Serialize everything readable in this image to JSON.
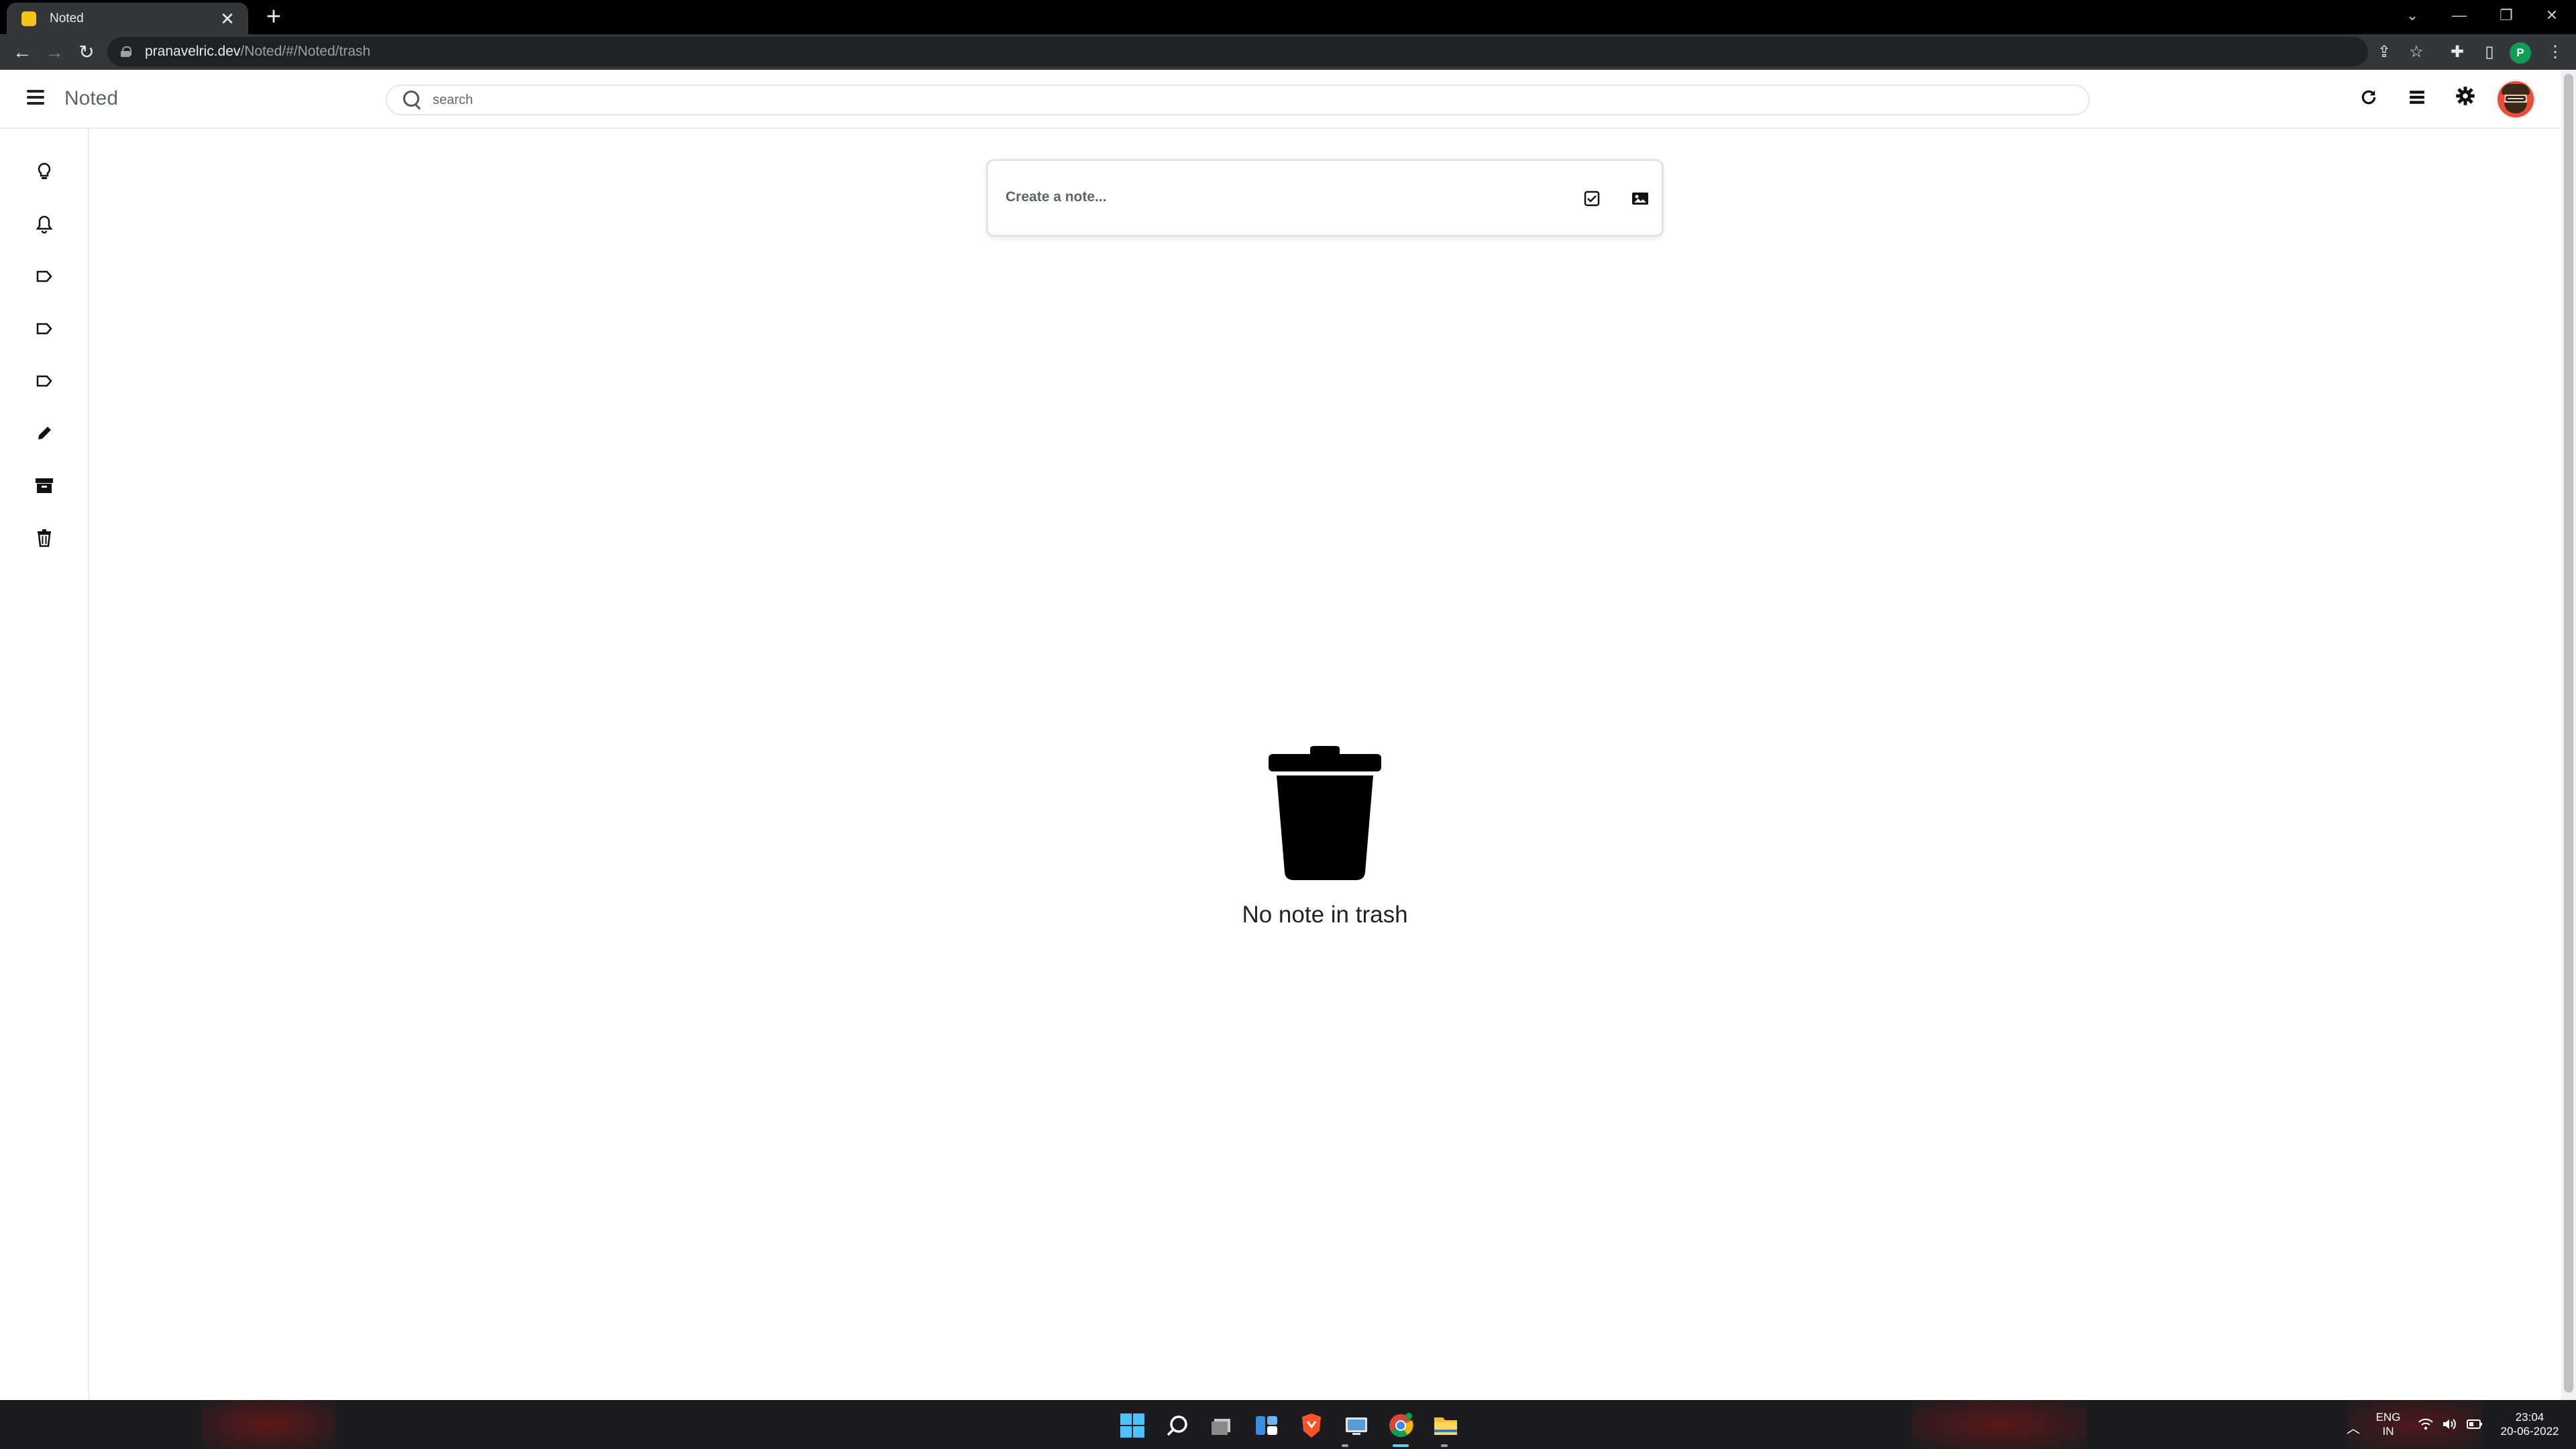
{
  "browser": {
    "tab_title": "Noted",
    "tab_close": "✕",
    "new_tab": "+",
    "url_host": "pranavelric.dev",
    "url_path": "/Noted/#/Noted/trash",
    "profile_initial": "P"
  },
  "app": {
    "title": "Noted",
    "search_placeholder": "search"
  },
  "note_input": {
    "placeholder": "Create a note..."
  },
  "empty_state": {
    "message": "No note in trash",
    "icon": "trash-icon"
  },
  "sidebar": {
    "items": [
      {
        "icon": "lightbulb-icon"
      },
      {
        "icon": "bell-icon"
      },
      {
        "icon": "label-icon"
      },
      {
        "icon": "label-icon"
      },
      {
        "icon": "label-icon"
      },
      {
        "icon": "pencil-icon"
      },
      {
        "icon": "archive-icon"
      },
      {
        "icon": "trash-icon"
      }
    ]
  },
  "taskbar": {
    "lang_top": "ENG",
    "lang_bottom": "IN",
    "time": "23:04",
    "date": "20-06-2022"
  },
  "colors": {
    "browser_frame": "#000000",
    "toolbar": "#35363a",
    "omnibox": "#202124",
    "taskbar": "#1c1c1f",
    "avatar_bg": "#e74c3c"
  }
}
